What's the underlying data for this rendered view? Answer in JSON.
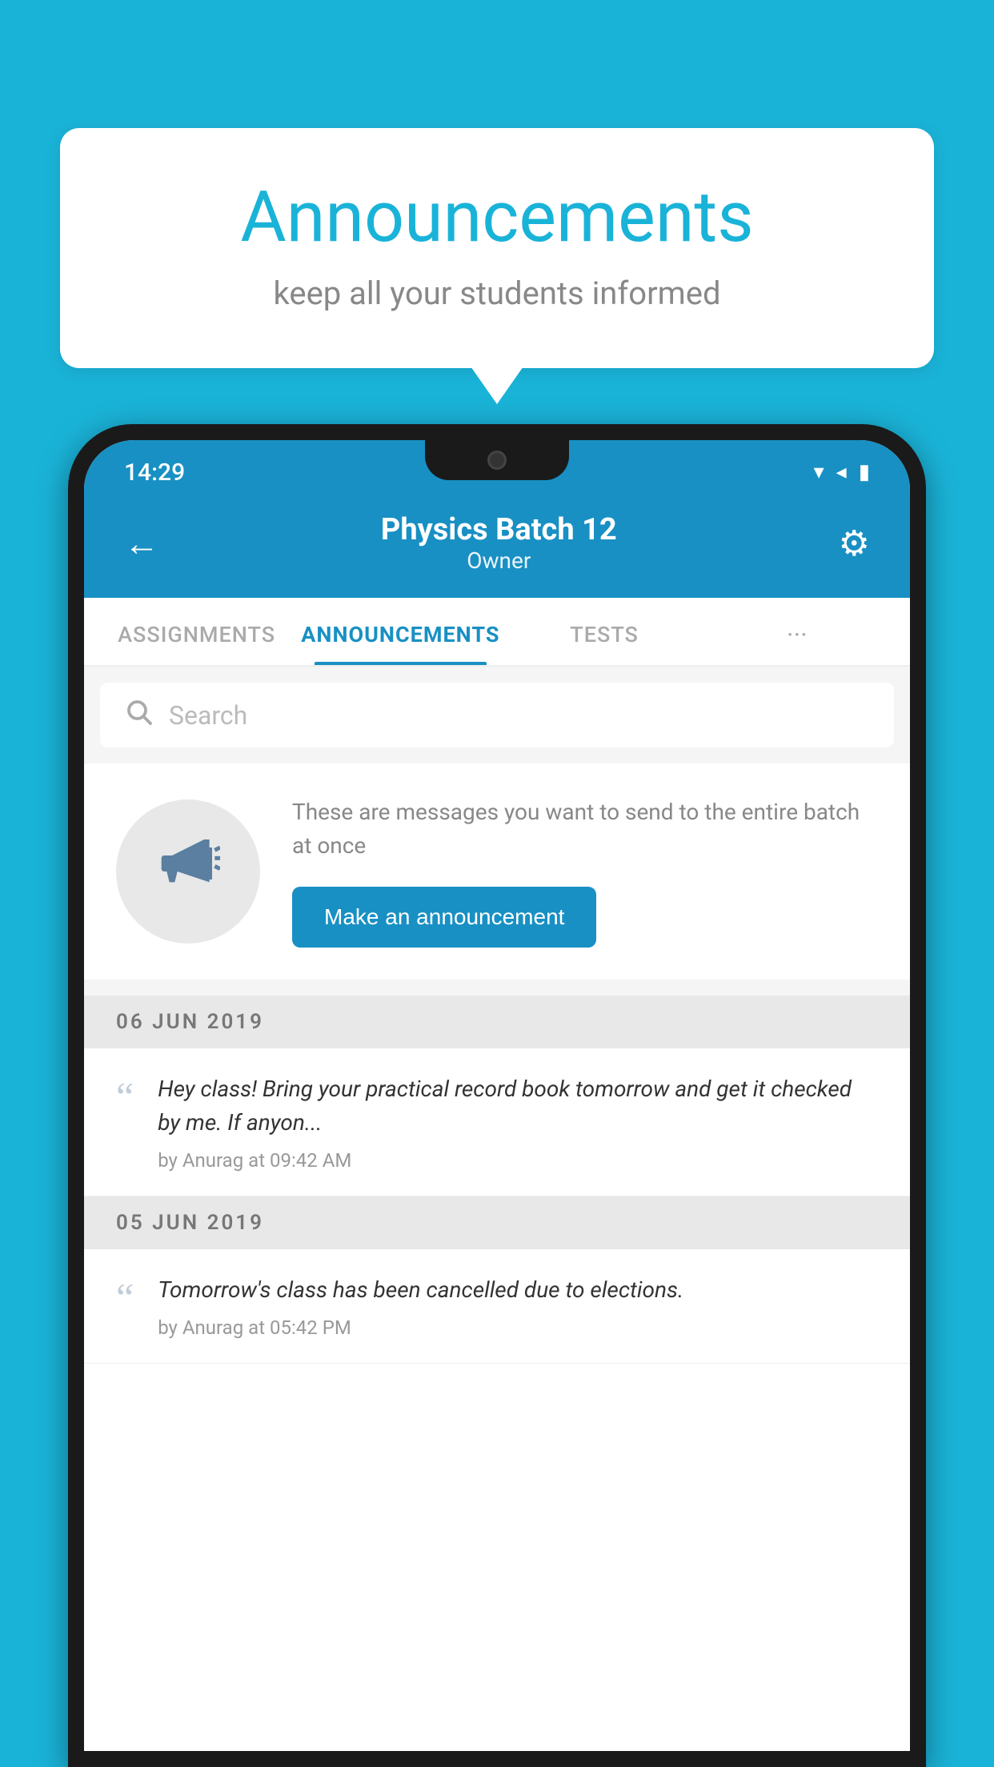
{
  "background": {
    "color": "#1ab3d8"
  },
  "speech_bubble": {
    "title": "Announcements",
    "subtitle": "keep all your students informed"
  },
  "status_bar": {
    "time": "14:29",
    "wifi": "▼",
    "signal": "▲",
    "battery": "▌"
  },
  "header": {
    "title": "Physics Batch 12",
    "subtitle": "Owner",
    "back_label": "←",
    "gear_label": "⚙"
  },
  "tabs": [
    {
      "label": "ASSIGNMENTS",
      "active": false
    },
    {
      "label": "ANNOUNCEMENTS",
      "active": true
    },
    {
      "label": "TESTS",
      "active": false
    },
    {
      "label": "···",
      "active": false
    }
  ],
  "search": {
    "placeholder": "Search"
  },
  "announcement_prompt": {
    "description": "These are messages you want to send to the entire batch at once",
    "button_label": "Make an announcement"
  },
  "date_groups": [
    {
      "date": "06  JUN  2019",
      "items": [
        {
          "text": "Hey class! Bring your practical record book tomorrow and get it checked by me. If anyon...",
          "meta": "by Anurag at 09:42 AM"
        }
      ]
    },
    {
      "date": "05  JUN  2019",
      "items": [
        {
          "text": "Tomorrow's class has been cancelled due to elections.",
          "meta": "by Anurag at 05:42 PM"
        }
      ]
    }
  ]
}
